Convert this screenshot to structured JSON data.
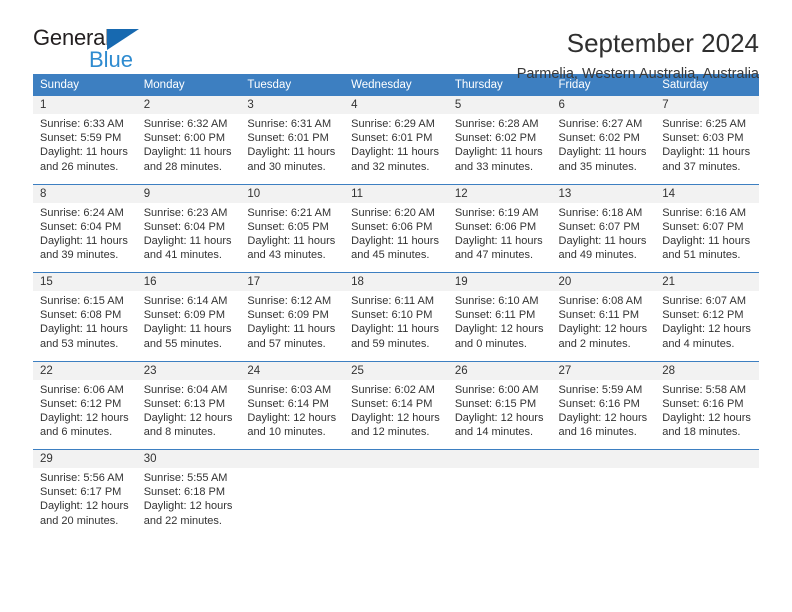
{
  "logo": {
    "word_one": "General",
    "word_two": "Blue",
    "triangle_icon": "triangle-icon",
    "triangle_color": "#1769b0",
    "blue_color": "#2e8bd0"
  },
  "header": {
    "title": "September 2024",
    "subtitle": "Parmelia, Western Australia, Australia",
    "header_bg": "#3d7fc1",
    "daynum_bg": "#f2f2f2"
  },
  "weekdays": [
    "Sunday",
    "Monday",
    "Tuesday",
    "Wednesday",
    "Thursday",
    "Friday",
    "Saturday"
  ],
  "labels": {
    "sunrise": "Sunrise:",
    "sunset": "Sunset:",
    "daylight": "Daylight:"
  },
  "weeks": [
    {
      "days": [
        {
          "num": "1",
          "sunrise": "Sunrise: 6:33 AM",
          "sunset": "Sunset: 5:59 PM",
          "daylight": "Daylight: 11 hours and 26 minutes."
        },
        {
          "num": "2",
          "sunrise": "Sunrise: 6:32 AM",
          "sunset": "Sunset: 6:00 PM",
          "daylight": "Daylight: 11 hours and 28 minutes."
        },
        {
          "num": "3",
          "sunrise": "Sunrise: 6:31 AM",
          "sunset": "Sunset: 6:01 PM",
          "daylight": "Daylight: 11 hours and 30 minutes."
        },
        {
          "num": "4",
          "sunrise": "Sunrise: 6:29 AM",
          "sunset": "Sunset: 6:01 PM",
          "daylight": "Daylight: 11 hours and 32 minutes."
        },
        {
          "num": "5",
          "sunrise": "Sunrise: 6:28 AM",
          "sunset": "Sunset: 6:02 PM",
          "daylight": "Daylight: 11 hours and 33 minutes."
        },
        {
          "num": "6",
          "sunrise": "Sunrise: 6:27 AM",
          "sunset": "Sunset: 6:02 PM",
          "daylight": "Daylight: 11 hours and 35 minutes."
        },
        {
          "num": "7",
          "sunrise": "Sunrise: 6:25 AM",
          "sunset": "Sunset: 6:03 PM",
          "daylight": "Daylight: 11 hours and 37 minutes."
        }
      ]
    },
    {
      "days": [
        {
          "num": "8",
          "sunrise": "Sunrise: 6:24 AM",
          "sunset": "Sunset: 6:04 PM",
          "daylight": "Daylight: 11 hours and 39 minutes."
        },
        {
          "num": "9",
          "sunrise": "Sunrise: 6:23 AM",
          "sunset": "Sunset: 6:04 PM",
          "daylight": "Daylight: 11 hours and 41 minutes."
        },
        {
          "num": "10",
          "sunrise": "Sunrise: 6:21 AM",
          "sunset": "Sunset: 6:05 PM",
          "daylight": "Daylight: 11 hours and 43 minutes."
        },
        {
          "num": "11",
          "sunrise": "Sunrise: 6:20 AM",
          "sunset": "Sunset: 6:06 PM",
          "daylight": "Daylight: 11 hours and 45 minutes."
        },
        {
          "num": "12",
          "sunrise": "Sunrise: 6:19 AM",
          "sunset": "Sunset: 6:06 PM",
          "daylight": "Daylight: 11 hours and 47 minutes."
        },
        {
          "num": "13",
          "sunrise": "Sunrise: 6:18 AM",
          "sunset": "Sunset: 6:07 PM",
          "daylight": "Daylight: 11 hours and 49 minutes."
        },
        {
          "num": "14",
          "sunrise": "Sunrise: 6:16 AM",
          "sunset": "Sunset: 6:07 PM",
          "daylight": "Daylight: 11 hours and 51 minutes."
        }
      ]
    },
    {
      "days": [
        {
          "num": "15",
          "sunrise": "Sunrise: 6:15 AM",
          "sunset": "Sunset: 6:08 PM",
          "daylight": "Daylight: 11 hours and 53 minutes."
        },
        {
          "num": "16",
          "sunrise": "Sunrise: 6:14 AM",
          "sunset": "Sunset: 6:09 PM",
          "daylight": "Daylight: 11 hours and 55 minutes."
        },
        {
          "num": "17",
          "sunrise": "Sunrise: 6:12 AM",
          "sunset": "Sunset: 6:09 PM",
          "daylight": "Daylight: 11 hours and 57 minutes."
        },
        {
          "num": "18",
          "sunrise": "Sunrise: 6:11 AM",
          "sunset": "Sunset: 6:10 PM",
          "daylight": "Daylight: 11 hours and 59 minutes."
        },
        {
          "num": "19",
          "sunrise": "Sunrise: 6:10 AM",
          "sunset": "Sunset: 6:11 PM",
          "daylight": "Daylight: 12 hours and 0 minutes."
        },
        {
          "num": "20",
          "sunrise": "Sunrise: 6:08 AM",
          "sunset": "Sunset: 6:11 PM",
          "daylight": "Daylight: 12 hours and 2 minutes."
        },
        {
          "num": "21",
          "sunrise": "Sunrise: 6:07 AM",
          "sunset": "Sunset: 6:12 PM",
          "daylight": "Daylight: 12 hours and 4 minutes."
        }
      ]
    },
    {
      "days": [
        {
          "num": "22",
          "sunrise": "Sunrise: 6:06 AM",
          "sunset": "Sunset: 6:12 PM",
          "daylight": "Daylight: 12 hours and 6 minutes."
        },
        {
          "num": "23",
          "sunrise": "Sunrise: 6:04 AM",
          "sunset": "Sunset: 6:13 PM",
          "daylight": "Daylight: 12 hours and 8 minutes."
        },
        {
          "num": "24",
          "sunrise": "Sunrise: 6:03 AM",
          "sunset": "Sunset: 6:14 PM",
          "daylight": "Daylight: 12 hours and 10 minutes."
        },
        {
          "num": "25",
          "sunrise": "Sunrise: 6:02 AM",
          "sunset": "Sunset: 6:14 PM",
          "daylight": "Daylight: 12 hours and 12 minutes."
        },
        {
          "num": "26",
          "sunrise": "Sunrise: 6:00 AM",
          "sunset": "Sunset: 6:15 PM",
          "daylight": "Daylight: 12 hours and 14 minutes."
        },
        {
          "num": "27",
          "sunrise": "Sunrise: 5:59 AM",
          "sunset": "Sunset: 6:16 PM",
          "daylight": "Daylight: 12 hours and 16 minutes."
        },
        {
          "num": "28",
          "sunrise": "Sunrise: 5:58 AM",
          "sunset": "Sunset: 6:16 PM",
          "daylight": "Daylight: 12 hours and 18 minutes."
        }
      ]
    },
    {
      "days": [
        {
          "num": "29",
          "sunrise": "Sunrise: 5:56 AM",
          "sunset": "Sunset: 6:17 PM",
          "daylight": "Daylight: 12 hours and 20 minutes."
        },
        {
          "num": "30",
          "sunrise": "Sunrise: 5:55 AM",
          "sunset": "Sunset: 6:18 PM",
          "daylight": "Daylight: 12 hours and 22 minutes."
        },
        {
          "num": "",
          "sunrise": "",
          "sunset": "",
          "daylight": ""
        },
        {
          "num": "",
          "sunrise": "",
          "sunset": "",
          "daylight": ""
        },
        {
          "num": "",
          "sunrise": "",
          "sunset": "",
          "daylight": ""
        },
        {
          "num": "",
          "sunrise": "",
          "sunset": "",
          "daylight": ""
        },
        {
          "num": "",
          "sunrise": "",
          "sunset": "",
          "daylight": ""
        }
      ]
    }
  ]
}
